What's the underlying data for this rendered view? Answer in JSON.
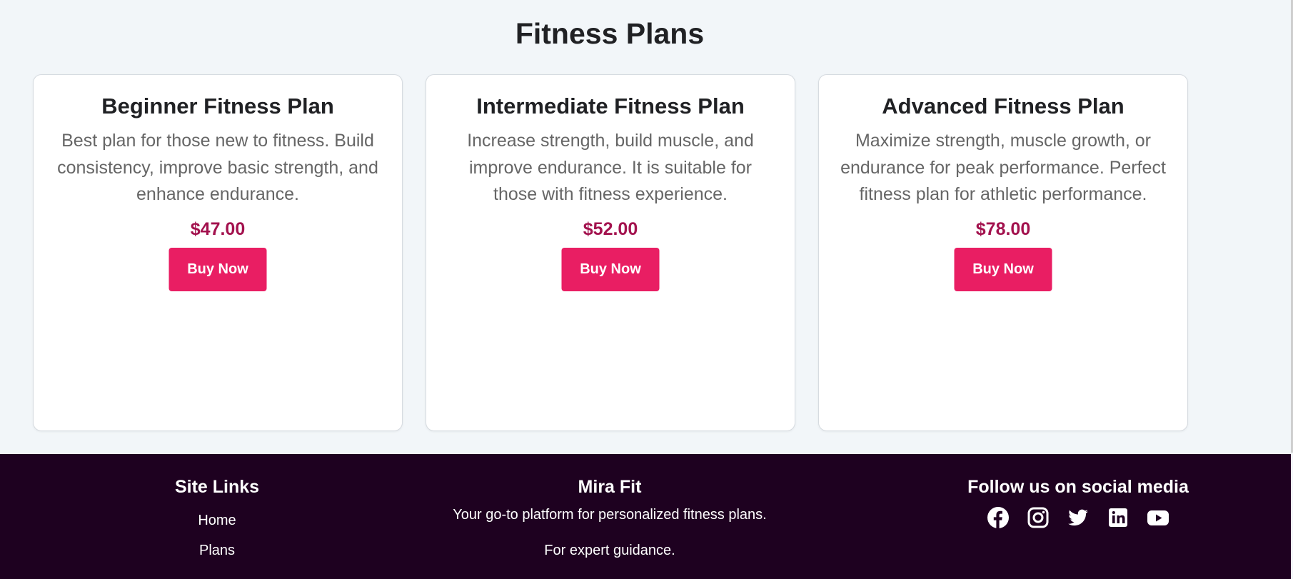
{
  "page": {
    "title": "Fitness Plans"
  },
  "plans": [
    {
      "title": "Beginner Fitness Plan",
      "description": "Best plan for those new to fitness. Build consistency, improve basic strength, and enhance endurance.",
      "price": "$47.00",
      "button": "Buy Now"
    },
    {
      "title": "Intermediate Fitness Plan",
      "description": "Increase strength, build muscle, and improve endurance. It is suitable for those with fitness experience.",
      "price": "$52.00",
      "button": "Buy Now"
    },
    {
      "title": "Advanced Fitness Plan",
      "description": "Maximize strength, muscle growth, or endurance for peak performance. Perfect fitness plan for athletic performance.",
      "price": "$78.00",
      "button": "Buy Now"
    }
  ],
  "footer": {
    "links": {
      "heading": "Site Links",
      "items": [
        "Home",
        "Plans"
      ]
    },
    "brand": {
      "name": "Mira Fit",
      "tagline": "Your go-to platform for personalized fitness plans.",
      "note": "For expert guidance."
    },
    "social": {
      "heading": "Follow us on social media",
      "icons": [
        "facebook-icon",
        "instagram-icon",
        "twitter-icon",
        "linkedin-icon",
        "youtube-icon"
      ]
    }
  },
  "colors": {
    "accent": "#e91e63",
    "price": "#a3124e",
    "footer_bg": "#1e0120",
    "page_bg": "#f2f6f9"
  }
}
